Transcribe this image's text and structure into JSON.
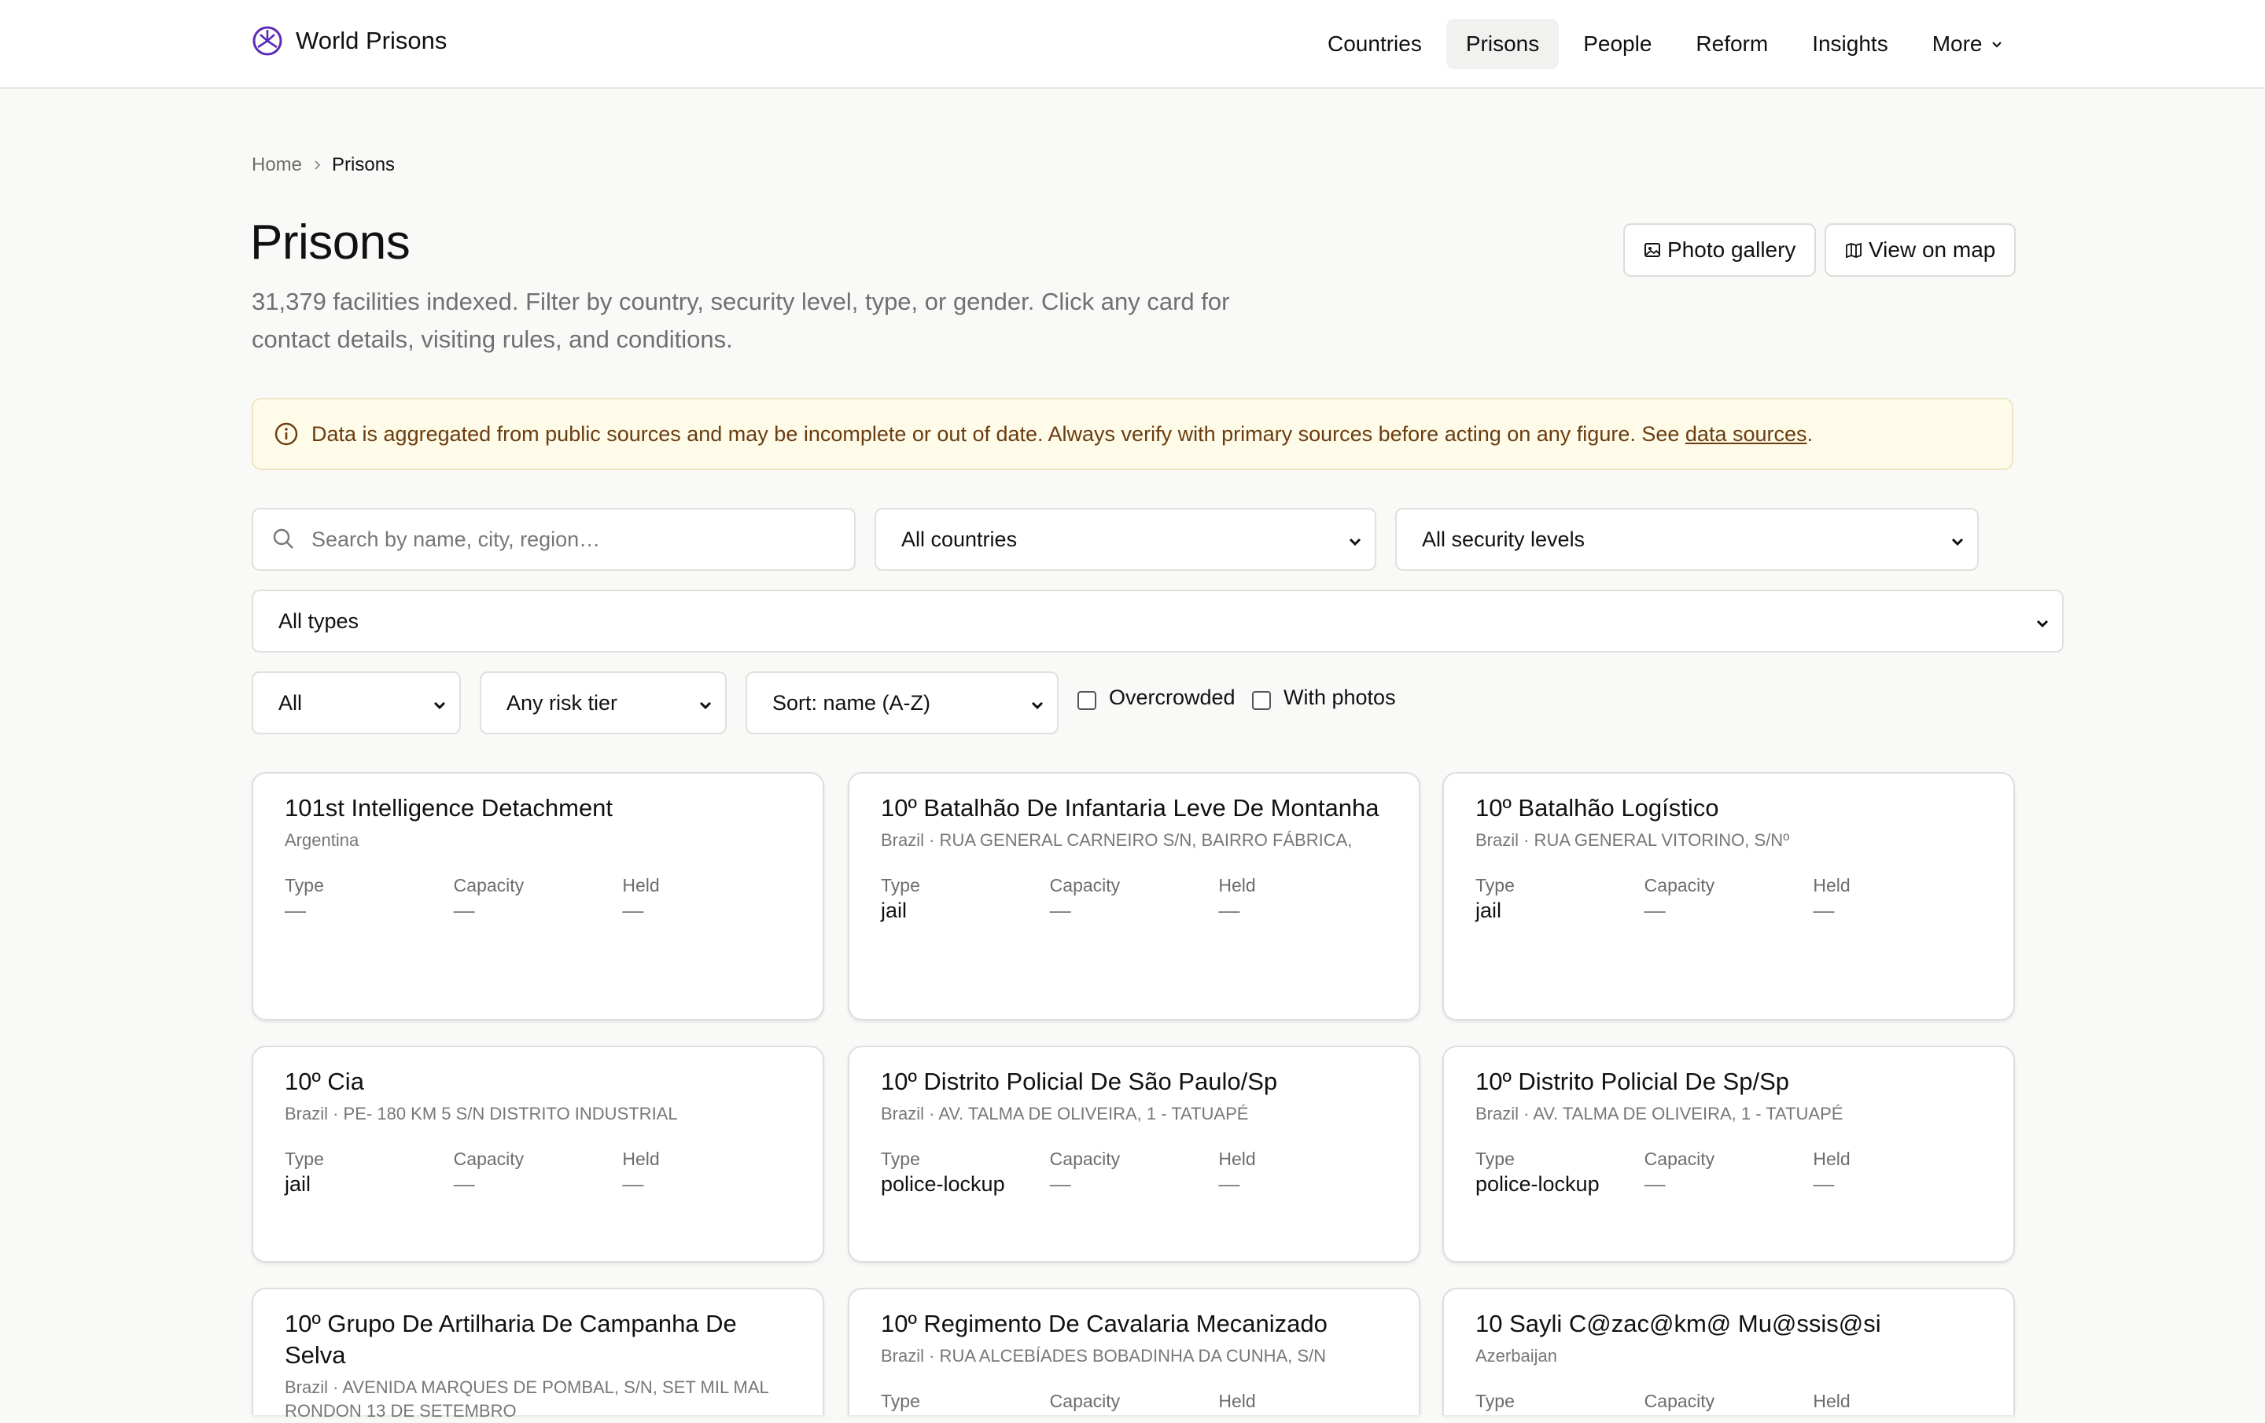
{
  "brand": {
    "name": "World Prisons"
  },
  "nav": {
    "items": [
      "Countries",
      "Prisons",
      "People",
      "Reform",
      "Insights",
      "More"
    ],
    "active": "Prisons"
  },
  "breadcrumb": {
    "home": "Home",
    "current": "Prisons"
  },
  "header": {
    "title": "Prisons",
    "subtitle": "31,379 facilities indexed. Filter by country, security level, type, or gender. Click any card for contact details, visiting rules, and conditions.",
    "photo_gallery": "Photo gallery",
    "view_on_map": "View on map"
  },
  "notice": {
    "text": "Data is aggregated from public sources and may be incomplete or out of date. Always verify with primary sources before acting on any figure. See ",
    "link": "data sources",
    "end": "."
  },
  "filters": {
    "search_placeholder": "Search by name, city, region…",
    "country": "All countries",
    "security": "All security levels",
    "type": "All types",
    "gender": "All",
    "risk": "Any risk tier",
    "sort": "Sort: name (A-Z)",
    "overcrowded": "Overcrowded",
    "with_photos": "With photos"
  },
  "labels": {
    "type": "Type",
    "capacity": "Capacity",
    "held": "Held"
  },
  "cards": [
    {
      "name": "101st Intelligence Detachment",
      "sub": "Argentina",
      "type": "—",
      "capacity": "—",
      "held": "—"
    },
    {
      "name": "10º Batalhão De Infantaria Leve De Montanha",
      "sub": "Brazil · RUA GENERAL CARNEIRO S/N, BAIRRO FÁBRICA,",
      "type": "jail",
      "capacity": "—",
      "held": "—"
    },
    {
      "name": "10º Batalhão Logístico",
      "sub": "Brazil · RUA GENERAL VITORINO, S/Nº",
      "type": "jail",
      "capacity": "—",
      "held": "—"
    },
    {
      "name": "10º Cia",
      "sub": "Brazil · PE- 180 KM 5 S/N DISTRITO INDUSTRIAL",
      "type": "jail",
      "capacity": "—",
      "held": "—"
    },
    {
      "name": "10º Distrito Policial De São Paulo/Sp",
      "sub": "Brazil · AV. TALMA DE OLIVEIRA, 1 - TATUAPÉ",
      "type": "police-lockup",
      "capacity": "—",
      "held": "—"
    },
    {
      "name": "10º Distrito Policial De Sp/Sp",
      "sub": "Brazil · AV. TALMA DE OLIVEIRA, 1 - TATUAPÉ",
      "type": "police-lockup",
      "capacity": "—",
      "held": "—"
    },
    {
      "name": "10º Grupo De Artilharia De Campanha De Selva",
      "sub": "Brazil · AVENIDA MARQUES DE POMBAL, S/N, SET MIL MAL RONDON 13 DE SETEMBRO",
      "type": "",
      "capacity": "",
      "held": ""
    },
    {
      "name": "10º Regimento De Cavalaria Mecanizado",
      "sub": "Brazil · RUA ALCEBÍADES BOBADINHA DA CUNHA, S/N",
      "type": "",
      "capacity": "",
      "held": ""
    },
    {
      "name": "10 Sayli C@zac@km@ Mu@ssis@si",
      "sub": "Azerbaijan",
      "type": "",
      "capacity": "",
      "held": ""
    }
  ]
}
